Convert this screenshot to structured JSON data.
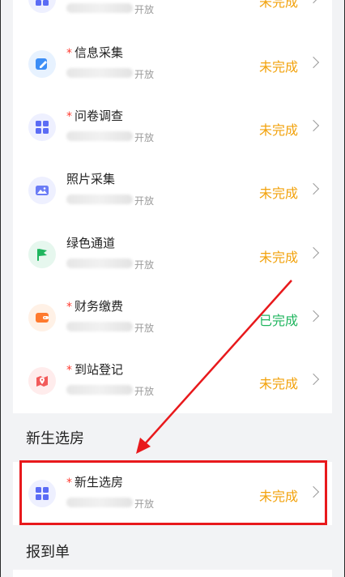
{
  "list": {
    "items": [
      {
        "title": "",
        "required": false,
        "open_text": "开放",
        "status": "未完成",
        "status_type": "todo",
        "icon": "grid-icon",
        "icon_bg": "#eef0ff"
      },
      {
        "title": "信息采集",
        "required": true,
        "open_text": "开放",
        "status": "未完成",
        "status_type": "todo",
        "icon": "edit-form-icon",
        "icon_bg": "#e7f2ff"
      },
      {
        "title": "问卷调查",
        "required": true,
        "open_text": "开放",
        "status": "未完成",
        "status_type": "todo",
        "icon": "grid-icon",
        "icon_bg": "#eef0ff"
      },
      {
        "title": "照片采集",
        "required": false,
        "open_text": "开放",
        "status": "未完成",
        "status_type": "todo",
        "icon": "image-icon",
        "icon_bg": "#eef0ff"
      },
      {
        "title": "绿色通道",
        "required": false,
        "open_text": "开放",
        "status": "未完成",
        "status_type": "todo",
        "icon": "flag-icon",
        "icon_bg": "#e6f7ee"
      },
      {
        "title": "财务缴费",
        "required": true,
        "open_text": "开放",
        "status": "已完成",
        "status_type": "done",
        "icon": "wallet-icon",
        "icon_bg": "#fff1e6"
      },
      {
        "title": "到站登记",
        "required": true,
        "open_text": "开放",
        "status": "未完成",
        "status_type": "todo",
        "icon": "map-pin-icon",
        "icon_bg": "#ffecec"
      }
    ]
  },
  "sections": {
    "room_selection": {
      "heading": "新生选房",
      "item": {
        "title": "新生选房",
        "required": true,
        "open_text": "开放",
        "status": "未完成",
        "status_type": "todo",
        "icon": "grid-icon",
        "icon_bg": "#eef0ff"
      }
    },
    "report": {
      "heading": "报到单"
    }
  },
  "colors": {
    "todo": "#f2a20c",
    "done": "#1fb55e",
    "required": "#ff3b30",
    "annotation": "#e8191c",
    "primary_icon": "#5b6cf5"
  }
}
